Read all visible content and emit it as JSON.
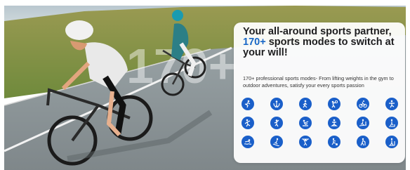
{
  "headline": {
    "line1": "Your all-around sports partner,",
    "accent": "170+",
    "line2_rest": " sports modes to switch at",
    "line3": "your will!"
  },
  "description": "170+ professional sports modes- From lifting weights in the gym to outdoor adventures, satisfy your every sports passion",
  "watermark": "170+",
  "colors": {
    "accent": "#1766c7",
    "icon_bg": "#1a5fc9"
  },
  "sport_icons": [
    "running-icon",
    "skipping-rope-icon",
    "walking-icon",
    "basketball-icon",
    "cycling-icon",
    "gymnastics-icon",
    "dancing-icon",
    "climbing-icon",
    "rowing-icon",
    "yoga-icon",
    "treadmill-icon",
    "stepper-icon",
    "swimming-icon",
    "skiing-icon",
    "weightlifting-icon",
    "football-icon",
    "hiking-icon",
    "indoor-walking-icon"
  ]
}
